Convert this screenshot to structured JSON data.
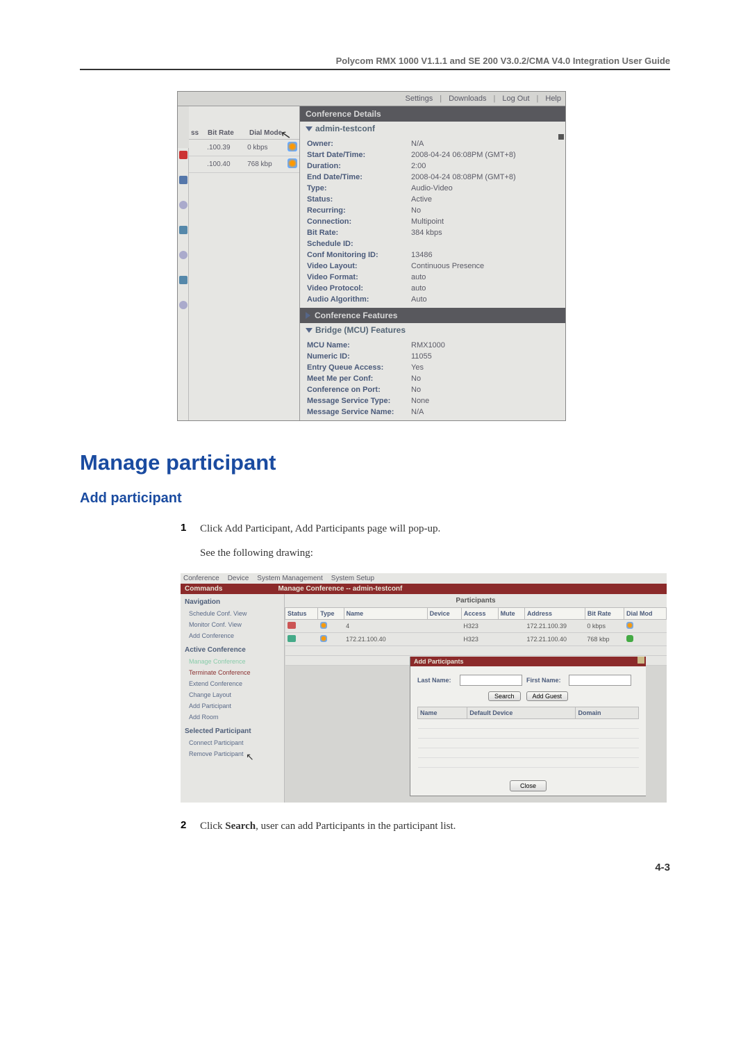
{
  "doc_header": "Polycom RMX 1000 V1.1.1 and SE 200 V3.0.2/CMA V4.0 Integration User Guide",
  "topbar": {
    "settings": "Settings",
    "downloads": "Downloads",
    "logout": "Log Out",
    "help": "Help"
  },
  "panel1": {
    "conf_details_hdr": "Conference Details",
    "conf_name": "admin-testconf",
    "left_cols": {
      "c1": "ss",
      "c2": "Bit Rate",
      "c3": "Dial Mode"
    },
    "left_rows": [
      {
        "a": ".100.39",
        "b": "0 kbps"
      },
      {
        "a": ".100.40",
        "b": "768 kbp"
      }
    ],
    "details": [
      {
        "lbl": "Owner:",
        "val": "N/A"
      },
      {
        "lbl": "Start Date/Time:",
        "val": "2008-04-24 06:08PM (GMT+8)"
      },
      {
        "lbl": "Duration:",
        "val": "2:00"
      },
      {
        "lbl": "End Date/Time:",
        "val": "2008-04-24 08:08PM (GMT+8)"
      },
      {
        "lbl": "Type:",
        "val": "Audio-Video"
      },
      {
        "lbl": "Status:",
        "val": "Active"
      },
      {
        "lbl": "Recurring:",
        "val": "No"
      },
      {
        "lbl": "Connection:",
        "val": "Multipoint"
      },
      {
        "lbl": "Bit Rate:",
        "val": "384 kbps"
      },
      {
        "lbl": "Schedule ID:",
        "val": ""
      },
      {
        "lbl": "Conf Monitoring ID:",
        "val": "13486"
      },
      {
        "lbl": "Video Layout:",
        "val": "Continuous Presence"
      },
      {
        "lbl": "Video Format:",
        "val": "auto"
      },
      {
        "lbl": "Video Protocol:",
        "val": "auto"
      },
      {
        "lbl": "Audio Algorithm:",
        "val": "Auto"
      }
    ],
    "conf_features_hdr": "Conference Features",
    "mcu_hdr": "Bridge (MCU) Features",
    "mcu": [
      {
        "lbl": "MCU Name:",
        "val": "RMX1000"
      },
      {
        "lbl": "Numeric ID:",
        "val": "11055"
      },
      {
        "lbl": "Entry Queue Access:",
        "val": "Yes"
      },
      {
        "lbl": "Meet Me per Conf:",
        "val": "No"
      },
      {
        "lbl": "Conference on Port:",
        "val": "No"
      },
      {
        "lbl": "Message Service Type:",
        "val": "None"
      },
      {
        "lbl": "Message Service Name:",
        "val": "N/A"
      }
    ]
  },
  "heading1": "Manage participant",
  "heading2": "Add participant",
  "step1_num": "1",
  "step1_text": "Click Add Participant, Add Participants page will pop-up.",
  "step1_sub": "See the following drawing:",
  "panel2": {
    "tabs": {
      "t1": "Conference",
      "t2": "Device",
      "t3": "System Management",
      "t4": "System Setup"
    },
    "redbar_left": "Commands",
    "redbar_right": "Manage Conference -- admin-testconf",
    "nav_hdr": "Navigation",
    "nav_items": {
      "i1": "Schedule Conf. View",
      "i2": "Monitor Conf. View",
      "i3": "Add Conference"
    },
    "active_hdr": "Active Conference",
    "active_items": {
      "i1": "Manage Conference",
      "i2": "Terminate Conference",
      "i3": "Extend Conference",
      "i4": "Change Layout",
      "i5": "Add Participant",
      "i6": "Add Room"
    },
    "sel_hdr": "Selected Participant",
    "sel_items": {
      "i1": "Connect Participant",
      "i2": "Remove Participant"
    },
    "participants_hdr": "Participants",
    "cols": {
      "c1": "Status",
      "c2": "Type",
      "c3": "Name",
      "c4": "Device",
      "c5": "Access",
      "c6": "Mute",
      "c7": "Address",
      "c8": "Bit Rate",
      "c9": "Dial Mod"
    },
    "rows": [
      {
        "name": "4",
        "access": "H323",
        "addr": "172.21.100.39",
        "br": "0 kbps"
      },
      {
        "name": "172.21.100.40",
        "access": "H323",
        "addr": "172.21.100.40",
        "br": "768 kbp"
      }
    ],
    "popup": {
      "title": "Add Participants",
      "last": "Last Name:",
      "first": "First Name:",
      "search": "Search",
      "addguest": "Add Guest",
      "pcols": {
        "c1": "Name",
        "c2": "Default Device",
        "c3": "Domain"
      },
      "close": "Close"
    }
  },
  "step2_num": "2",
  "step2_pre": "Click ",
  "step2_bold": "Search",
  "step2_post": ", user can add Participants in the participant list.",
  "page_num": "4-3"
}
